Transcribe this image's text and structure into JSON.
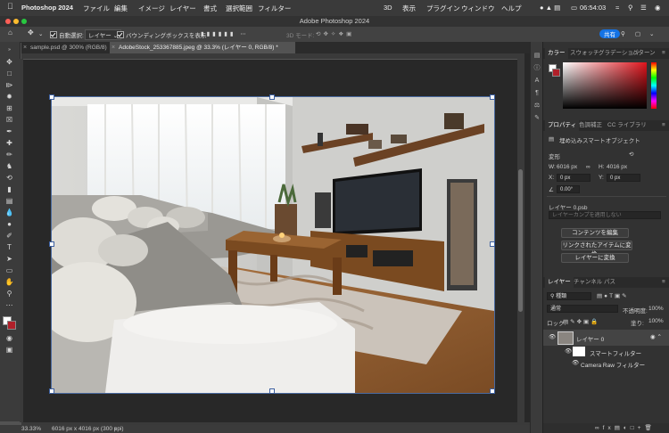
{
  "menubar": {
    "app_name": "Photoshop 2024",
    "items": [
      "ファイル",
      "編集",
      "イメージ",
      "レイヤー",
      "書式",
      "選択範囲",
      "フィルター"
    ],
    "right_items": [
      "3D",
      "表示",
      "プラグイン",
      "ウィンドウ",
      "ヘルプ"
    ],
    "clock": "06:54:03"
  },
  "titlebar": {
    "title": "Adobe Photoshop 2024"
  },
  "options": {
    "auto_select_label": "自動選択:",
    "auto_select_value": "レイヤー",
    "bounding_box_label": "バウンディングボックスを表示",
    "mode_3d": "3D モード:",
    "share_label": "共有"
  },
  "tabs": [
    {
      "label": "sample.psd @ 300% (RGB/8)"
    },
    {
      "label": "AdobeStock_253367885.jpeg @ 33.3% (レイヤー 0, RGB/8) *"
    }
  ],
  "status": {
    "zoom": "33.33%",
    "doc_info": "6016 px x 4016 px (300 ppi)"
  },
  "color_panel": {
    "tabs": [
      "カラー",
      "スウォッチ",
      "グラデーション",
      "パターン"
    ],
    "hue_color": "#e0141c"
  },
  "properties": {
    "tabs": [
      "プロパティ",
      "色調補正",
      "CC ライブラリ"
    ],
    "object_type": "埋め込みスマートオブジェクト",
    "transform_label": "変形",
    "w_label": "W:",
    "w_value": "6016 px",
    "h_label": "H:",
    "h_value": "4016 px",
    "x_label": "X:",
    "x_value": "0 px",
    "y_label": "Y:",
    "y_value": "0 px",
    "angle_value": "0.00°",
    "file_label": "レイヤー 0.psb",
    "comp_placeholder": "レイヤーカンプを適用しない",
    "btn_edit": "コンテンツを編集",
    "btn_relink": "リンクされたアイテムに変換...",
    "btn_convert": "レイヤーに変換"
  },
  "layers": {
    "tabs": [
      "レイヤー",
      "チャンネル",
      "パス"
    ],
    "kind_label": "種類",
    "blend_mode": "通常",
    "opacity_label": "不透明度:",
    "opacity_value": "100%",
    "lock_label": "ロック:",
    "fill_label": "塗り:",
    "fill_value": "100%",
    "rows": [
      {
        "name": "レイヤー 0"
      },
      {
        "name": "スマートフィルター"
      },
      {
        "name": "Camera Raw フィルター"
      }
    ]
  }
}
